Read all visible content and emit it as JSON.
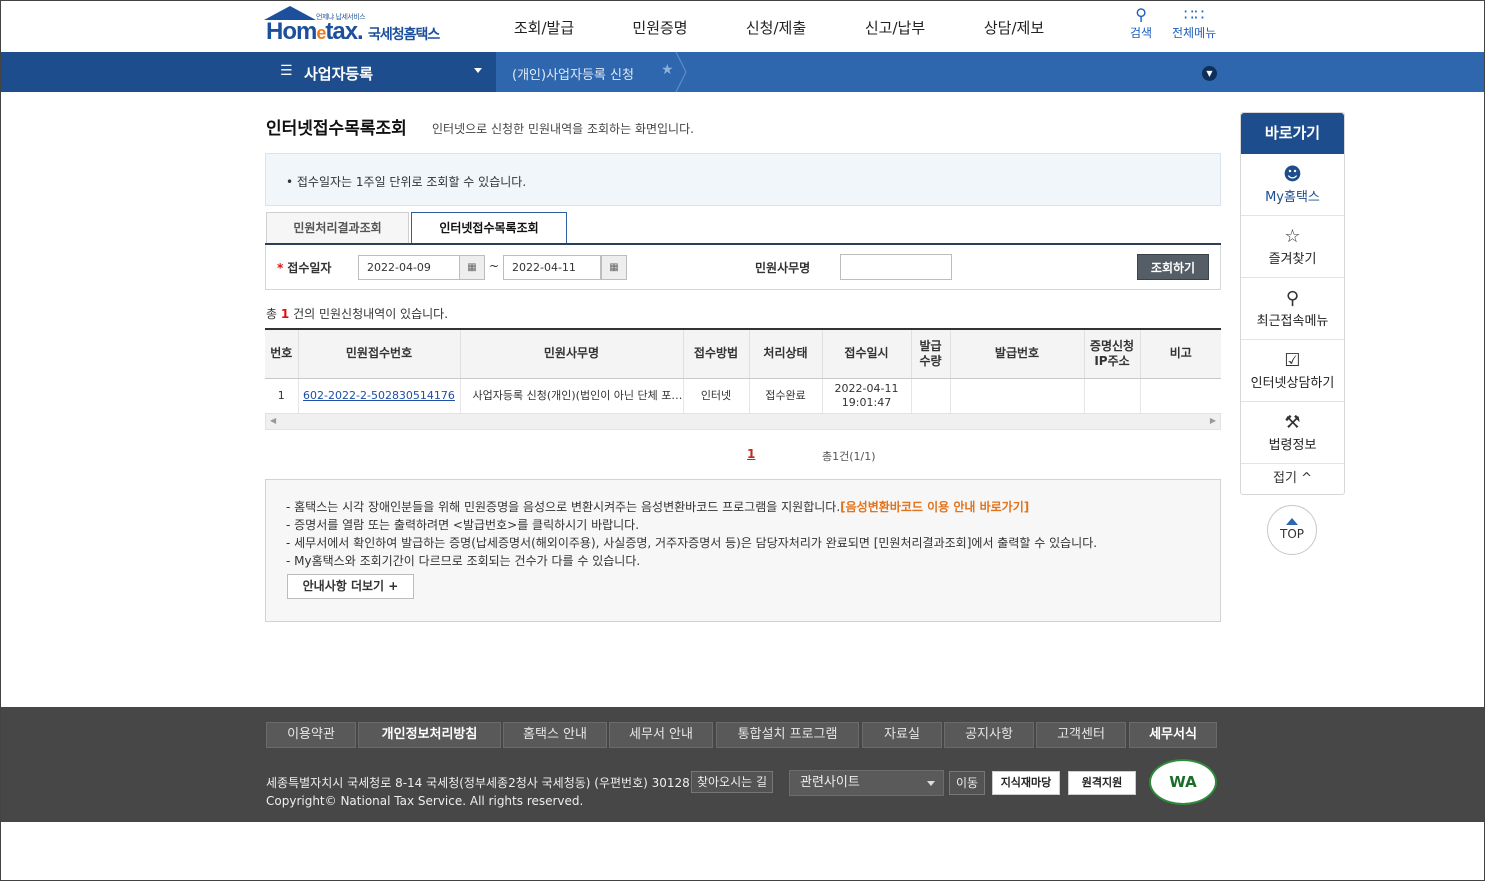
{
  "header": {
    "logo_tagline": "언제냐 납세서비스",
    "logo_brand_pre": "Hom",
    "logo_brand_e": "e",
    "logo_brand_post": "tax.",
    "logo_kor": "국세청홈택스",
    "nav": [
      "조회/발급",
      "민원증명",
      "신청/제출",
      "신고/납부",
      "상담/제보"
    ],
    "search_label": "검색",
    "allmenu_label": "전체메뉴"
  },
  "navbar": {
    "section": "사업자등록",
    "breadcrumb": "(개인)사업자등록 신청"
  },
  "page": {
    "title": "인터넷접수목록조회",
    "desc": "인터넷으로 신청한 민원내역을 조회하는 화면입니다.",
    "notice": "• 접수일자는 1주일 단위로 조회할 수 있습니다."
  },
  "tabs": [
    "민원처리결과조회",
    "인터넷접수목록조회"
  ],
  "form": {
    "date_label": "접수일자",
    "date_from": "2022-04-09",
    "date_to": "2022-04-11",
    "tilde": "~",
    "office_label": "민원사무명",
    "office_value": "",
    "search_button": "조회하기"
  },
  "result": {
    "prefix": "총",
    "count": "1",
    "suffix": "건의 민원신청내역이 있습니다."
  },
  "table": {
    "headers": [
      "번호",
      "민원접수번호",
      "민원사무명",
      "접수방법",
      "처리상태",
      "접수일시",
      "발급\n수량",
      "발급번호",
      "증명신청\nIP주소",
      "비고"
    ],
    "rows": [
      {
        "no": "1",
        "receipt_no": "602-2022-2-502830514176",
        "office": "사업자등록 신청(개인)(법인이 아닌 단체 포함)",
        "method": "인터넷",
        "status": "접수완료",
        "date": "2022-04-11",
        "time": "19:01:47",
        "qty": "",
        "issue_no": "",
        "ip": "",
        "note": ""
      }
    ]
  },
  "pager": {
    "current": "1",
    "total": "총1건(1/1)"
  },
  "guide": {
    "line1": "- 홈택스는 시각 장애인분들을 위해 민원증명을 음성으로 변환시켜주는 음성변환바코드 프로그램을 지원합니다.",
    "line1_link": "[음성변환바코드 이용 안내 바로가기]",
    "line2": "- 증명서를 열람 또는 출력하려면 <발급번호>를 클릭하시기 바랍니다.",
    "line3": "- 세무서에서 확인하여 발급하는 증명(납세증명서(해외이주용), 사실증명, 거주자증명서 등)은 담당자처리가 완료되면 [민원처리결과조회]에서 출력할 수 있습니다.",
    "line4": "- My홈택스와 조회기간이 다르므로 조회되는 건수가 다를 수 있습니다.",
    "more_button": "안내사항 더보기 +"
  },
  "quick": {
    "title": "바로가기",
    "items": [
      "My홈택스",
      "즐겨찾기",
      "최근접속메뉴",
      "인터넷상담하기",
      "법령정보"
    ],
    "fold": "접기 ^",
    "top": "TOP"
  },
  "footer": {
    "links": [
      "이용약관",
      "개인정보처리방침",
      "홈택스 안내",
      "세무서 안내",
      "통합설치 프로그램",
      "자료실",
      "공지사항",
      "고객센터",
      "세무서식"
    ],
    "address": "세종특별자치시 국세청로 8-14 국세청(정부세종2청사 국세청동) (우편번호) 30128",
    "directions": "찾아오시는 길",
    "copyright": "Copyright© National Tax Service. All rights reserved.",
    "related_site": "관련사이트",
    "go": "이동",
    "badge1": "지식재마당",
    "badge2": "원격지원",
    "wa": "WA"
  },
  "colors": {
    "brand_blue": "#1d4d8c",
    "nav_blue": "#2e67ad",
    "accent_orange": "#e2731b",
    "required_red": "#dd1111",
    "footer_bg": "#474747"
  }
}
